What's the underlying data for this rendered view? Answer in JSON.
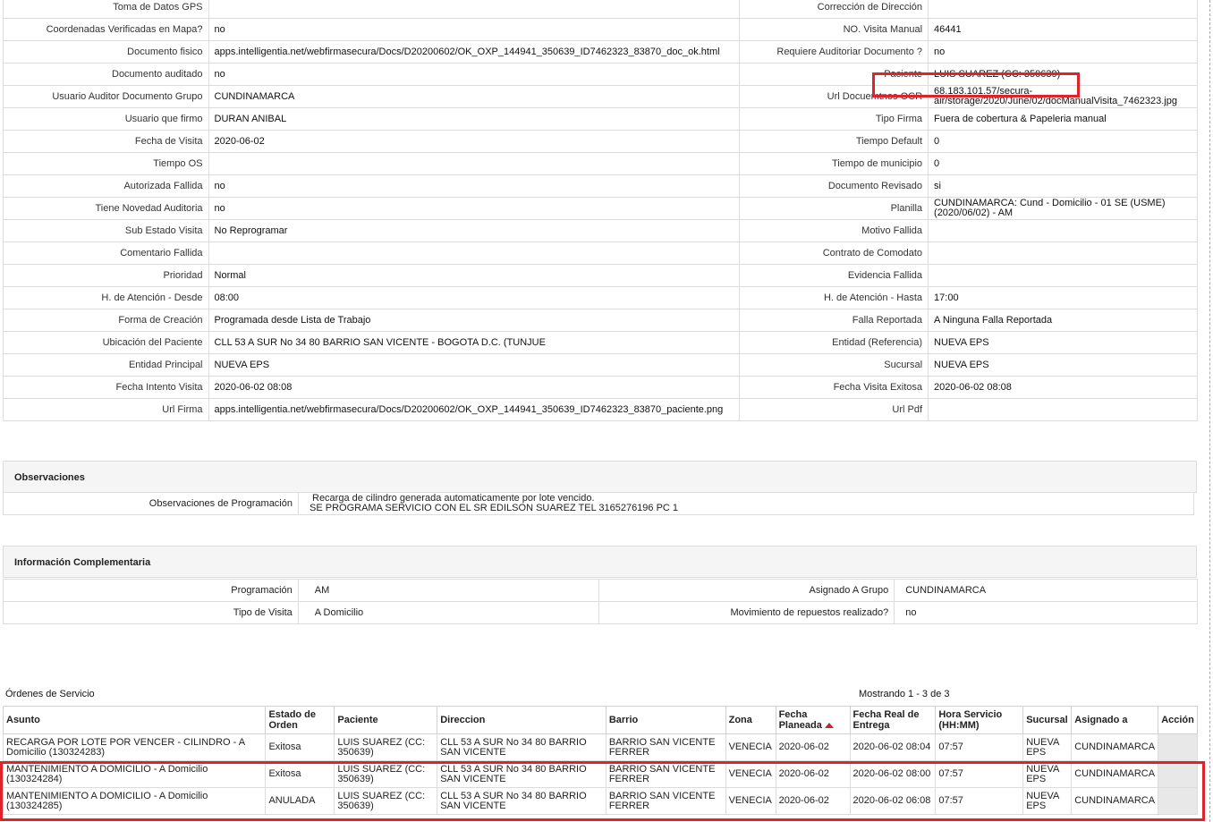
{
  "detail_rows": [
    {
      "l1": "Toma de Datos GPS",
      "v1": "",
      "l2": "Corrección de Dirección",
      "v2": ""
    },
    {
      "l1": "Coordenadas Verificadas en Mapa?",
      "v1": "no",
      "l2": "NO. Visita Manual",
      "v2": "46441"
    },
    {
      "l1": "Documento fisico",
      "v1": "apps.intelligentia.net/webfirmasecura/Docs/D20200602/OK_OXP_144941_350639_ID7462323_83870_doc_ok.html",
      "l2": "Requiere Auditoriar Documento ?",
      "v2": "no"
    },
    {
      "l1": "Documento auditado",
      "v1": "no",
      "l2": "Paciente",
      "v2": "LUIS SUAREZ (CC: 350639)"
    },
    {
      "l1": "Usuario Auditor Documento Grupo",
      "v1": "CUNDINAMARCA",
      "l2": "Url Docuemtnos OCR",
      "v2": "68.183.101.57/secura-air/storage/2020/June/02/docManualVisita_7462323.jpg"
    },
    {
      "l1": "Usuario que firmo",
      "v1": "DURAN ANIBAL",
      "l2": "Tipo Firma",
      "v2": "Fuera de cobertura & Papeleria manual"
    },
    {
      "l1": "Fecha de Visita",
      "v1": "2020-06-02",
      "l2": "Tiempo Default",
      "v2": "0"
    },
    {
      "l1": "Tiempo OS",
      "v1": "",
      "l2": "Tiempo de municipio",
      "v2": "0"
    },
    {
      "l1": "Autorizada Fallida",
      "v1": "no",
      "l2": "Documento Revisado",
      "v2": "si"
    },
    {
      "l1": "Tiene Novedad Auditoria",
      "v1": "no",
      "l2": "Planilla",
      "v2": "CUNDINAMARCA: Cund - Domicilio - 01 SE (USME) (2020/06/02) - AM"
    },
    {
      "l1": "Sub Estado Visita",
      "v1": "No Reprogramar",
      "l2": "Motivo Fallida",
      "v2": ""
    },
    {
      "l1": "Comentario Fallida",
      "v1": "",
      "l2": "Contrato de Comodato",
      "v2": ""
    },
    {
      "l1": "Prioridad",
      "v1": "Normal",
      "l2": "Evidencia Fallida",
      "v2": ""
    },
    {
      "l1": "H. de Atención - Desde",
      "v1": "08:00",
      "l2": "H. de Atención - Hasta",
      "v2": "17:00"
    },
    {
      "l1": "Forma de Creación",
      "v1": "Programada desde Lista de Trabajo",
      "l2": "Falla Reportada",
      "v2": "A Ninguna Falla Reportada"
    },
    {
      "l1": "Ubicación del Paciente",
      "v1": "CLL 53 A SUR No 34 80 BARRIO SAN VICENTE - BOGOTA D.C. (TUNJUE",
      "l2": "Entidad (Referencia)",
      "v2": "NUEVA EPS"
    },
    {
      "l1": "Entidad Principal",
      "v1": "NUEVA EPS",
      "l2": "Sucursal",
      "v2": "NUEVA EPS"
    },
    {
      "l1": "Fecha Intento Visita",
      "v1": "2020-06-02 08:08",
      "l2": "Fecha Visita Exitosa",
      "v2": "2020-06-02 08:08"
    },
    {
      "l1": "Url Firma",
      "v1": "apps.intelligentia.net/webfirmasecura/Docs/D20200602/OK_OXP_144941_350639_ID7462323_83870_paciente.png",
      "l2": "Url Pdf",
      "v2": ""
    }
  ],
  "observaciones": {
    "title": "Observaciones",
    "label": "Observaciones de Programación",
    "line1": "Recarga de cilindro generada automaticamente por lote vencido.",
    "line2": "SE PROGRAMA SERVICIO CON EL SR EDILSON SUAREZ TEL 3165276196 PC 1"
  },
  "info": {
    "title": "Información Complementaria",
    "rows": [
      {
        "l1": "Programación",
        "v1": "AM",
        "l2": "Asignado A Grupo",
        "v2": "CUNDINAMARCA"
      },
      {
        "l1": "Tipo de Visita",
        "v1": "A Domicilio",
        "l2": "Movimiento de repuestos realizado?",
        "v2": "no"
      }
    ]
  },
  "orders": {
    "title": "Órdenes de Servicio",
    "count": "Mostrando 1 - 3 de 3",
    "headers": [
      "Asunto",
      "Estado de Orden",
      "Paciente",
      "Direccion",
      "Barrio",
      "Zona",
      "Fecha Planeada",
      "Fecha Real de Entrega",
      "Hora Servicio (HH:MM)",
      "Sucursal",
      "Asignado a",
      "Acción"
    ],
    "rows": [
      [
        "RECARGA POR LOTE POR VENCER - CILINDRO - A Domicilio (130324283)",
        "Exitosa",
        "LUIS SUAREZ (CC: 350639)",
        "CLL 53 A SUR No 34 80 BARRIO SAN VICENTE",
        "BARRIO SAN VICENTE FERRER",
        "VENECIA",
        "2020-06-02",
        "2020-06-02 08:04",
        "07:57",
        "NUEVA EPS",
        "CUNDINAMARCA",
        ""
      ],
      [
        "MANTENIMIENTO A DOMICILIO - A Domicilio (130324284)",
        "Exitosa",
        "LUIS SUAREZ (CC: 350639)",
        "CLL 53 A SUR No 34 80 BARRIO SAN VICENTE",
        "BARRIO SAN VICENTE FERRER",
        "VENECIA",
        "2020-06-02",
        "2020-06-02 08:00",
        "07:57",
        "NUEVA EPS",
        "CUNDINAMARCA",
        ""
      ],
      [
        "MANTENIMIENTO A DOMICILIO - A Domicilio (130324285)",
        "ANULADA",
        "LUIS SUAREZ (CC: 350639)",
        "CLL 53 A SUR No 34 80 BARRIO SAN VICENTE",
        "BARRIO SAN VICENTE FERRER",
        "VENECIA",
        "2020-06-02",
        "2020-06-02 06:08",
        "07:57",
        "NUEVA EPS",
        "CUNDINAMARCA",
        ""
      ]
    ]
  },
  "colors": {
    "highlight": "#e0232b",
    "sort_arrow": "#c0282d"
  }
}
